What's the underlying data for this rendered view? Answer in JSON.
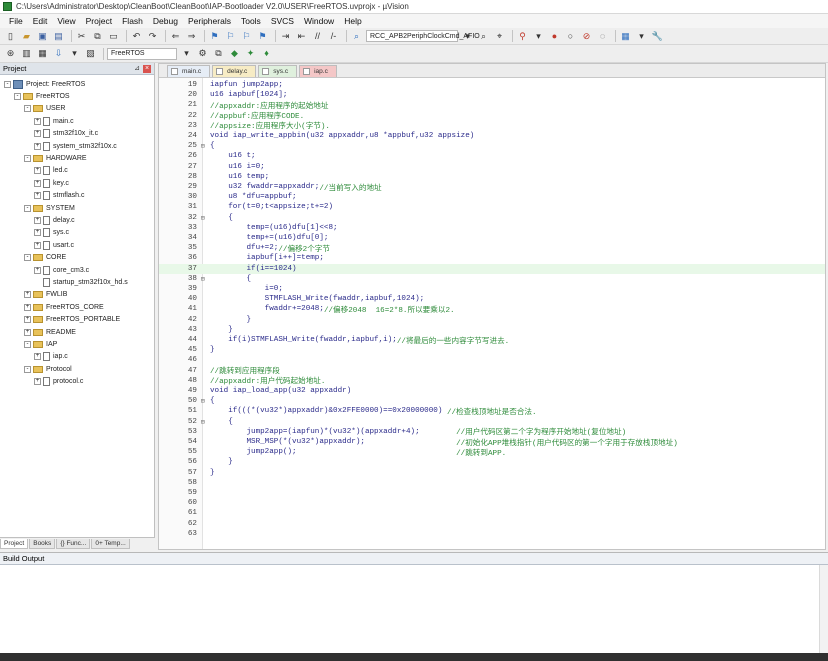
{
  "window": {
    "title": "C:\\Users\\Administrator\\Desktop\\CleanBoot\\CleanBoot\\IAP-Bootloader V2.0\\USER\\FreeRTOS.uvprojx - µVision"
  },
  "menu": [
    "File",
    "Edit",
    "View",
    "Project",
    "Flash",
    "Debug",
    "Peripherals",
    "Tools",
    "SVCS",
    "Window",
    "Help"
  ],
  "toolbar": {
    "function_combo": "RCC_APB2PeriphClockCmd_AFIO",
    "target_select": "FreeRTOS"
  },
  "project_panel": {
    "title": "Project",
    "tree": [
      {
        "label": "Project: FreeRTOS",
        "level": 0,
        "kind": "root",
        "expander": "-"
      },
      {
        "label": "FreeRTOS",
        "level": 1,
        "kind": "folder",
        "expander": "-"
      },
      {
        "label": "USER",
        "level": 2,
        "kind": "folder",
        "expander": "-"
      },
      {
        "label": "main.c",
        "level": 3,
        "kind": "file",
        "expander": "+"
      },
      {
        "label": "stm32f10x_it.c",
        "level": 3,
        "kind": "file",
        "expander": "+"
      },
      {
        "label": "system_stm32f10x.c",
        "level": 3,
        "kind": "file",
        "expander": "+"
      },
      {
        "label": "HARDWARE",
        "level": 2,
        "kind": "folder",
        "expander": "-"
      },
      {
        "label": "led.c",
        "level": 3,
        "kind": "file",
        "expander": "+"
      },
      {
        "label": "key.c",
        "level": 3,
        "kind": "file",
        "expander": "+"
      },
      {
        "label": "stmflash.c",
        "level": 3,
        "kind": "file",
        "expander": "+"
      },
      {
        "label": "SYSTEM",
        "level": 2,
        "kind": "folder",
        "expander": "-"
      },
      {
        "label": "delay.c",
        "level": 3,
        "kind": "file",
        "expander": "+"
      },
      {
        "label": "sys.c",
        "level": 3,
        "kind": "file",
        "expander": "+"
      },
      {
        "label": "usart.c",
        "level": 3,
        "kind": "file",
        "expander": "+"
      },
      {
        "label": "CORE",
        "level": 2,
        "kind": "folder",
        "expander": "-"
      },
      {
        "label": "core_cm3.c",
        "level": 3,
        "kind": "file",
        "expander": "+"
      },
      {
        "label": "startup_stm32f10x_hd.s",
        "level": 3,
        "kind": "file",
        "expander": ""
      },
      {
        "label": "FWLIB",
        "level": 2,
        "kind": "folder",
        "expander": "+"
      },
      {
        "label": "FreeRTOS_CORE",
        "level": 2,
        "kind": "folder",
        "expander": "+"
      },
      {
        "label": "FreeRTOS_PORTABLE",
        "level": 2,
        "kind": "folder",
        "expander": "+"
      },
      {
        "label": "README",
        "level": 2,
        "kind": "folder",
        "expander": "+"
      },
      {
        "label": "IAP",
        "level": 2,
        "kind": "folder",
        "expander": "-"
      },
      {
        "label": "iap.c",
        "level": 3,
        "kind": "file",
        "expander": "+"
      },
      {
        "label": "Protocol",
        "level": 2,
        "kind": "folder",
        "expander": "-"
      },
      {
        "label": "protocol.c",
        "level": 3,
        "kind": "file",
        "expander": "+"
      }
    ],
    "tabs": [
      "Project",
      "Books",
      "{} Func...",
      "0+ Temp..."
    ]
  },
  "editor": {
    "tabs": [
      {
        "label": "main.c",
        "style": "t-main"
      },
      {
        "label": "delay.c",
        "style": "t-delay"
      },
      {
        "label": "sys.c",
        "style": "t-sys"
      },
      {
        "label": "iap.c",
        "style": "t-iap"
      }
    ],
    "highlight_line": 37,
    "lines": [
      {
        "n": "19",
        "fold": "",
        "code": "iapfun jump2app;",
        "cmt": ""
      },
      {
        "n": "20",
        "fold": "",
        "code": "u16 iapbuf[1024];",
        "cmt": ""
      },
      {
        "n": "21",
        "fold": "",
        "code": "",
        "cmt": "//appxaddr:应用程序的起始地址"
      },
      {
        "n": "22",
        "fold": "",
        "code": "",
        "cmt": "//appbuf:应用程序CODE."
      },
      {
        "n": "23",
        "fold": "",
        "code": "",
        "cmt": "//appsize:应用程序大小(字节)."
      },
      {
        "n": "24",
        "fold": "",
        "code": "void iap_write_appbin(u32 appxaddr,u8 *appbuf,u32 appsize)",
        "cmt": ""
      },
      {
        "n": "25",
        "fold": "⊟",
        "code": "{",
        "cmt": ""
      },
      {
        "n": "26",
        "fold": "",
        "code": "    u16 t;",
        "cmt": ""
      },
      {
        "n": "27",
        "fold": "",
        "code": "    u16 i=0;",
        "cmt": ""
      },
      {
        "n": "28",
        "fold": "",
        "code": "    u16 temp;",
        "cmt": ""
      },
      {
        "n": "29",
        "fold": "",
        "code": "    u32 fwaddr=appxaddr;",
        "cmt": "//当前写入的地址"
      },
      {
        "n": "30",
        "fold": "",
        "code": "    u8 *dfu=appbuf;",
        "cmt": ""
      },
      {
        "n": "31",
        "fold": "",
        "code": "    for(t=0;t<appsize;t+=2)",
        "cmt": ""
      },
      {
        "n": "32",
        "fold": "⊟",
        "code": "    {",
        "cmt": ""
      },
      {
        "n": "33",
        "fold": "",
        "code": "        temp=(u16)dfu[1]<<8;",
        "cmt": ""
      },
      {
        "n": "34",
        "fold": "",
        "code": "        temp+=(u16)dfu[0];",
        "cmt": ""
      },
      {
        "n": "35",
        "fold": "",
        "code": "        dfu+=2;",
        "cmt": "//偏移2个字节"
      },
      {
        "n": "36",
        "fold": "",
        "code": "        iapbuf[i++]=temp;",
        "cmt": ""
      },
      {
        "n": "37",
        "fold": "",
        "code": "        if(i==1024)",
        "cmt": ""
      },
      {
        "n": "38",
        "fold": "⊟",
        "code": "        {",
        "cmt": ""
      },
      {
        "n": "39",
        "fold": "",
        "code": "            i=0;",
        "cmt": ""
      },
      {
        "n": "40",
        "fold": "",
        "code": "            STMFLASH_Write(fwaddr,iapbuf,1024);",
        "cmt": ""
      },
      {
        "n": "41",
        "fold": "",
        "code": "            fwaddr+=2048;",
        "cmt": "//偏移2048  16=2*8.所以要乘以2."
      },
      {
        "n": "42",
        "fold": "",
        "code": "        }",
        "cmt": ""
      },
      {
        "n": "43",
        "fold": "",
        "code": "    }",
        "cmt": ""
      },
      {
        "n": "44",
        "fold": "",
        "code": "    if(i)STMFLASH_Write(fwaddr,iapbuf,i);",
        "cmt": "//将最后的一些内容字节写进去."
      },
      {
        "n": "45",
        "fold": "",
        "code": "}",
        "cmt": ""
      },
      {
        "n": "46",
        "fold": "",
        "code": "",
        "cmt": ""
      },
      {
        "n": "47",
        "fold": "",
        "code": "",
        "cmt": "//跳转到应用程序段"
      },
      {
        "n": "48",
        "fold": "",
        "code": "",
        "cmt": "//appxaddr:用户代码起始地址."
      },
      {
        "n": "49",
        "fold": "",
        "code": "void iap_load_app(u32 appxaddr)",
        "cmt": ""
      },
      {
        "n": "50",
        "fold": "⊟",
        "code": "{",
        "cmt": ""
      },
      {
        "n": "51",
        "fold": "",
        "code": "    if(((*(vu32*)appxaddr)&0x2FFE0000)==0x20000000)",
        "cmt": " //检查栈顶地址是否合法."
      },
      {
        "n": "52",
        "fold": "⊟",
        "code": "    {",
        "cmt": ""
      },
      {
        "n": "53",
        "fold": "",
        "code": "        jump2app=(iapfun)*(vu32*)(appxaddr+4);        ",
        "cmt": "//用户代码区第二个字为程序开始地址(复位地址)"
      },
      {
        "n": "54",
        "fold": "",
        "code": "        MSR_MSP(*(vu32*)appxaddr);                    ",
        "cmt": "//初始化APP堆栈指针(用户代码区的第一个字用于存放栈顶地址)"
      },
      {
        "n": "55",
        "fold": "",
        "code": "        jump2app();                                   ",
        "cmt": "//跳转到APP."
      },
      {
        "n": "56",
        "fold": "",
        "code": "    }",
        "cmt": ""
      },
      {
        "n": "57",
        "fold": "",
        "code": "}",
        "cmt": ""
      },
      {
        "n": "58",
        "fold": "",
        "code": "",
        "cmt": ""
      },
      {
        "n": "59",
        "fold": "",
        "code": "",
        "cmt": ""
      },
      {
        "n": "60",
        "fold": "",
        "code": "",
        "cmt": ""
      },
      {
        "n": "61",
        "fold": "",
        "code": "",
        "cmt": ""
      },
      {
        "n": "62",
        "fold": "",
        "code": "",
        "cmt": ""
      },
      {
        "n": "63",
        "fold": "",
        "code": "",
        "cmt": ""
      }
    ]
  },
  "build_output": {
    "title": "Build Output"
  },
  "colors": {
    "code": "#2a2a8a",
    "comment": "#2e8b3a",
    "current_line": "#e8f8e8",
    "tab_iap": "#f4c7c7"
  }
}
